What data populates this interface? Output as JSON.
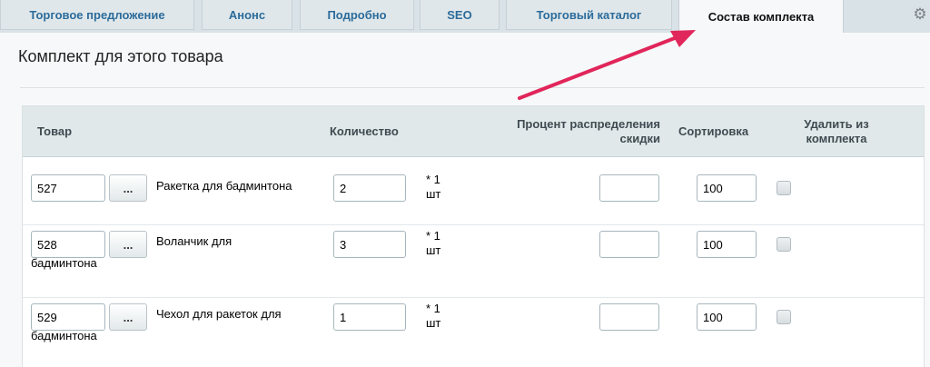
{
  "tabs": [
    {
      "label": "Торговое предложение",
      "active": false
    },
    {
      "label": "Анонс",
      "active": false
    },
    {
      "label": "Подробно",
      "active": false
    },
    {
      "label": "SEO",
      "active": false
    },
    {
      "label": "Торговый каталог",
      "active": false
    },
    {
      "label": "Состав комплекта",
      "active": true
    }
  ],
  "settings_icon": "gear-icon",
  "page_title": "Комплект для этого товара",
  "table": {
    "headers": {
      "product": "Товар",
      "quantity": "Количество",
      "discount": "Процент распределения\nскидки",
      "sort": "Сортировка",
      "remove": "Удалить из\nкомплекта"
    },
    "rows": [
      {
        "id": "527",
        "browse_label": "...",
        "name_line1": "Ракетка для бадминтона",
        "name_line2": "",
        "quantity": "2",
        "unit": "* 1\nшт",
        "discount": "",
        "sort": "100",
        "remove": false
      },
      {
        "id": "528",
        "browse_label": "...",
        "name_line1": "Воланчик для",
        "name_line2": "бадминтона",
        "quantity": "3",
        "unit": "* 1\nшт",
        "discount": "",
        "sort": "100",
        "remove": false
      },
      {
        "id": "529",
        "browse_label": "...",
        "name_line1": "Чехол для ракеток для",
        "name_line2": "бадминтона",
        "quantity": "1",
        "unit": "* 1\nшт",
        "discount": "",
        "sort": "100",
        "remove": false
      }
    ]
  },
  "colors": {
    "tab_text": "#2c6b9a",
    "arrow": "#e0265a"
  }
}
